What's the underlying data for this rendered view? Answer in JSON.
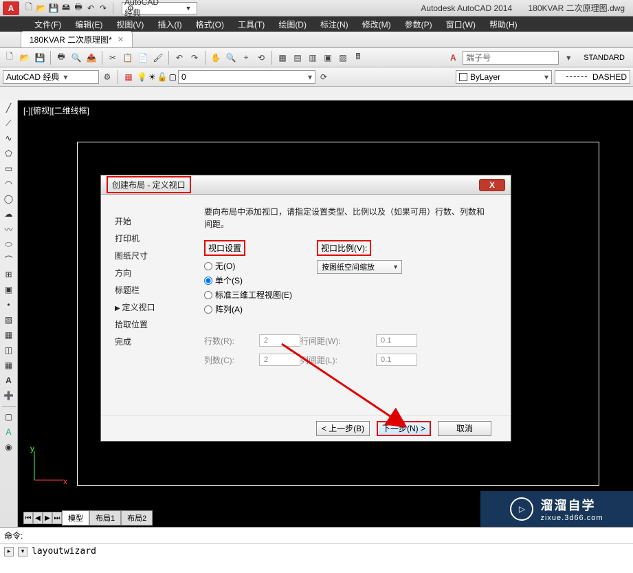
{
  "app": {
    "logo_text": "A",
    "name": "Autodesk AutoCAD 2014",
    "filename": "180KVAR 二次原理图.dwg",
    "search_placeholder": "AutoCAD 经典"
  },
  "menubar": {
    "file": "文件(F)",
    "edit": "编辑(E)",
    "view": "视图(V)",
    "insert": "插入(I)",
    "format": "格式(O)",
    "tools": "工具(T)",
    "draw": "绘图(D)",
    "dimension": "标注(N)",
    "modify": "修改(M)",
    "parametric": "参数(P)",
    "window": "窗口(W)",
    "help": "帮助(H)"
  },
  "tabs": {
    "doc1": "180KVAR 二次原理图*"
  },
  "combos": {
    "workspace": "AutoCAD 经典",
    "layer_state": "0",
    "bylayer": "ByLayer",
    "linetype": "DASHED",
    "text_style_hint": "端子号",
    "standard": "STANDARD"
  },
  "drawing": {
    "viewport_label": "[-][俯视][二维线框]",
    "axis_y": "y",
    "axis_x": "x"
  },
  "model_tabs": {
    "model": "模型",
    "layout1": "布局1",
    "layout2": "布局2"
  },
  "command": {
    "prompt": "命令:",
    "entered": "layoutwizard"
  },
  "dialog": {
    "title": "创建布局 - 定义视口",
    "close": "X",
    "nav": {
      "start": "开始",
      "printer": "打印机",
      "paper": "图纸尺寸",
      "orient": "方向",
      "titleblock": "标题栏",
      "viewports": "定义视口",
      "pick": "拾取位置",
      "finish": "完成"
    },
    "desc": "要向布局中添加视口，请指定设置类型、比例以及（如果可用）行数、列数和间距。",
    "section_vp_setting": "视口设置",
    "section_vp_scale": "视口比例(V):",
    "radios": {
      "none": "无(O)",
      "single": "单个(S)",
      "std3d": "标准三维工程视图(E)",
      "array": "阵列(A)"
    },
    "scale_select": "按图纸空间缩放",
    "inputs": {
      "rows_label": "行数(R):",
      "rows_val": "2",
      "rowsp_label": "行间距(W):",
      "rowsp_val": "0.1",
      "cols_label": "列数(C):",
      "cols_val": "2",
      "colsp_label": "列间距(L):",
      "colsp_val": "0.1"
    },
    "buttons": {
      "back": "< 上一步(B)",
      "next": "下一步(N) >",
      "cancel": "取消"
    }
  },
  "watermark": {
    "big": "溜溜自学",
    "small": "zixue.3d66.com",
    "play": "▷"
  }
}
